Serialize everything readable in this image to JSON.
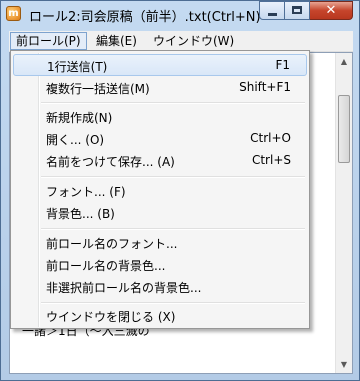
{
  "window": {
    "title": "ロール2:司会原稿（前半）.txt(Ctrl+N)",
    "icon": "app-icon",
    "icon_letter": "m"
  },
  "caption": {
    "close_symbol": "✕"
  },
  "menubar": {
    "items": [
      {
        "label": "前ロール(P)"
      },
      {
        "label": "編集(E)"
      },
      {
        "label": "ウインドウ(W)"
      }
    ]
  },
  "dropdown": {
    "items": [
      {
        "label": "1行送信(T)",
        "shortcut": "F1"
      },
      {
        "label": "複数行一括送信(M)",
        "shortcut": "Shift+F1"
      },
      {
        "label": "新規作成(N)",
        "shortcut": ""
      },
      {
        "label": "開く... (O)",
        "shortcut": "Ctrl+O"
      },
      {
        "label": "名前をつけて保存... (A)",
        "shortcut": "Ctrl+S"
      },
      {
        "label": "フォント... (F)",
        "shortcut": ""
      },
      {
        "label": "背景色... (B)",
        "shortcut": ""
      },
      {
        "label": "前ロール名のフォント...",
        "shortcut": ""
      },
      {
        "label": "前ロール名の背景色...",
        "shortcut": ""
      },
      {
        "label": "非選択前ロール名の背景色...",
        "shortcut": ""
      },
      {
        "label": "ウインドウを閉じる (X)",
        "shortcut": ""
      }
    ]
  },
  "editor": {
    "visible_fragment": "一諸＞1日（～入三滅の"
  },
  "colors": {
    "frame": "#b9d1ea",
    "highlight": "#d9e7f8",
    "close_button": "#c6452c"
  }
}
